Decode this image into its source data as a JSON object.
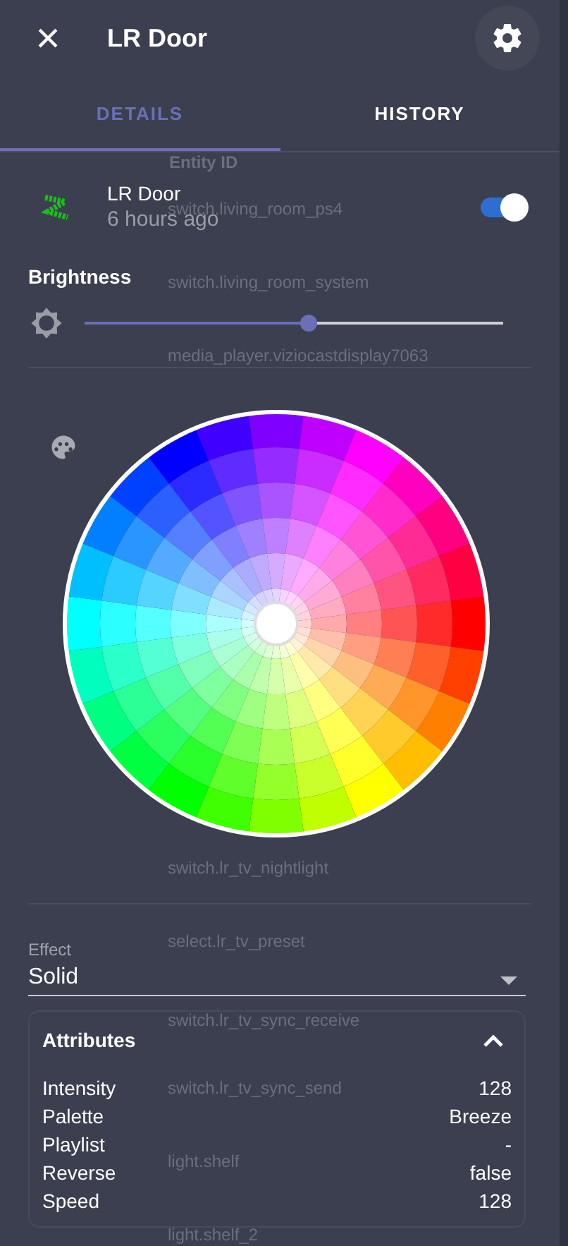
{
  "header": {
    "close": "×",
    "title": "LR Door"
  },
  "tabs": [
    {
      "label": "DETAILS",
      "selected": true
    },
    {
      "label": "HISTORY",
      "selected": false
    }
  ],
  "entity": {
    "name": "LR Door",
    "last_changed": "6 hours ago",
    "on": true
  },
  "brightness": {
    "label": "Brightness",
    "level": 0.535
  },
  "effect": {
    "label": "Effect",
    "value": "Solid"
  },
  "attributes": {
    "title": "Attributes",
    "expanded": true,
    "rows": [
      {
        "name": "Intensity",
        "value": "128"
      },
      {
        "name": "Palette",
        "value": "Breeze"
      },
      {
        "name": "Playlist",
        "value": "-"
      },
      {
        "name": "Reverse",
        "value": "false"
      },
      {
        "name": "Speed",
        "value": "128"
      }
    ]
  },
  "background_list": [
    "Entity ID",
    "switch.living_room_ps4",
    "switch.living_room_system",
    "media_player.viziocastdisplay7063",
    "switch.lr_tv_nightlight",
    "select.lr_tv_preset",
    "switch.lr_tv_sync_receive",
    "switch.lr_tv_sync_send",
    "light.shelf",
    "light.shelf_2"
  ]
}
